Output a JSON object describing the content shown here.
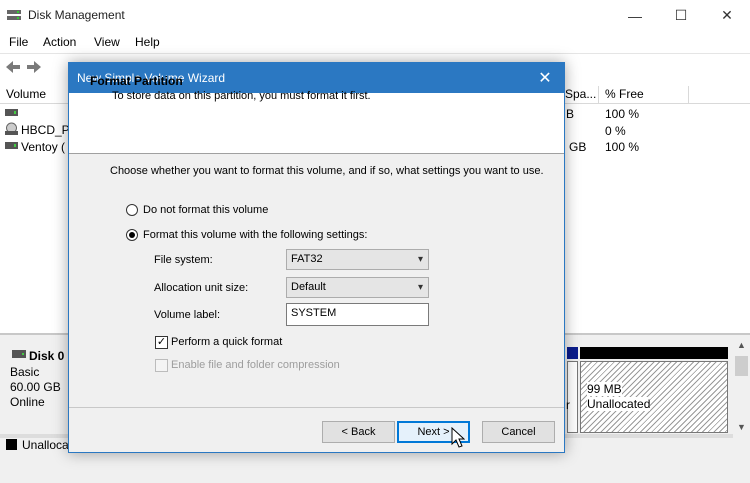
{
  "window": {
    "title": "Disk Management",
    "controls": {
      "minimize": "—",
      "maximize": "☐",
      "close": "✕"
    }
  },
  "menu": [
    "File",
    "Action",
    "View",
    "Help"
  ],
  "volume_list": {
    "headers": [
      "Volume",
      "Spa...",
      "% Free"
    ],
    "rows": [
      {
        "name": "",
        "space": "B",
        "free": "100 %"
      },
      {
        "name": "HBCD_PE",
        "space": "",
        "free": "0 %"
      },
      {
        "name": "Ventoy (",
        "space": "GB",
        "free": "100 %"
      }
    ]
  },
  "disk_panel": {
    "name": "Disk 0",
    "type": "Basic",
    "size": "60.00 GB",
    "status": "Online",
    "unalloc_size": "99 MB",
    "unalloc_label": "Unallocated",
    "mid_label": "r",
    "legend_unalloc": "Unalloca"
  },
  "wizard": {
    "title": "New Simple Volume Wizard",
    "close": "✕",
    "heading": "Format Partition",
    "subheading": "To store data on this partition, you must format it first.",
    "instructions": "Choose whether you want to format this volume, and if so, what settings you want to use.",
    "option_no_format": "Do not format this volume",
    "option_format": "Format this volume with the following settings:",
    "file_system_label": "File system:",
    "file_system_value": "FAT32",
    "alloc_label": "Allocation unit size:",
    "alloc_value": "Default",
    "volume_label_label": "Volume label:",
    "volume_label_value": "SYSTEM",
    "quick_format": "Perform a quick format",
    "compression": "Enable file and folder compression",
    "back": "< Back",
    "next": "Next >",
    "cancel": "Cancel"
  }
}
